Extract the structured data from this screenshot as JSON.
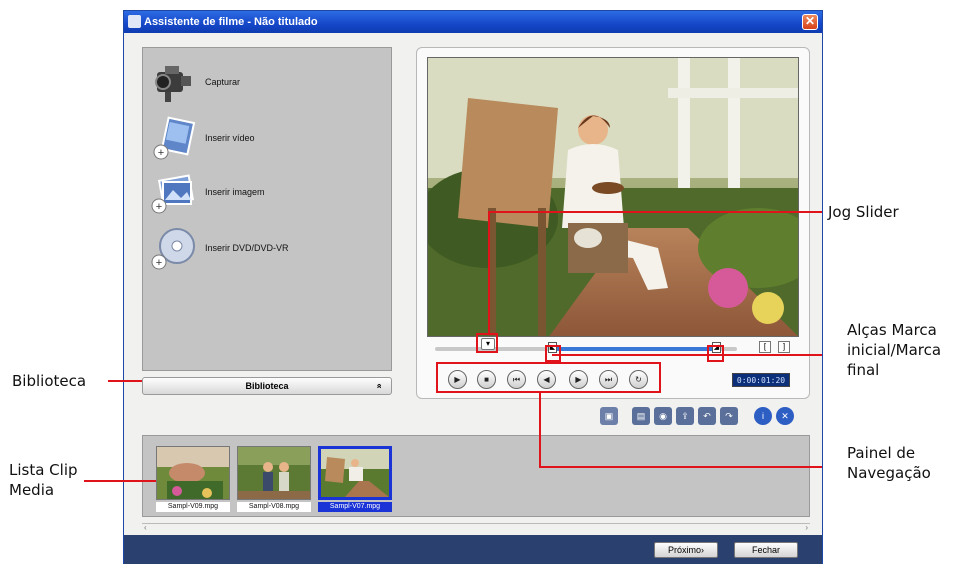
{
  "window": {
    "title": "Assistente de filme - Não titulado",
    "close_glyph": "✕"
  },
  "library": {
    "items": [
      {
        "label": "Capturar",
        "icon": "camcorder-icon"
      },
      {
        "label": "Inserir vídeo",
        "icon": "video-file-icon"
      },
      {
        "label": "Inserir imagem",
        "icon": "image-file-icon"
      },
      {
        "label": "Inserir DVD/DVD-VR",
        "icon": "dvd-disc-icon"
      }
    ],
    "bar_label": "Biblioteca",
    "bar_chevron": "»"
  },
  "preview": {
    "timecode": "0:00:01:20",
    "playhead_fraction": 0.19,
    "mark_in_fraction": 0.38,
    "mark_out_fraction": 0.92,
    "bracket_in": "[",
    "bracket_out": "]",
    "nav_buttons": [
      {
        "name": "play-button",
        "glyph": "▶"
      },
      {
        "name": "stop-button",
        "glyph": "■"
      },
      {
        "name": "home-button",
        "glyph": "⏮"
      },
      {
        "name": "previous-frame-button",
        "glyph": "◀"
      },
      {
        "name": "next-frame-button",
        "glyph": "▶"
      },
      {
        "name": "end-button",
        "glyph": "⏭"
      },
      {
        "name": "repeat-button",
        "glyph": "↻"
      }
    ]
  },
  "toolbar": {
    "icons": [
      "import-icon",
      "movie-template-icon",
      "theme-icon",
      "export-icon",
      "undo-icon",
      "redo-icon",
      "help-icon",
      "delete-icon"
    ]
  },
  "clips": [
    {
      "name": "Sampl-V09.mpg",
      "selected": false
    },
    {
      "name": "Sampl-V08.mpg",
      "selected": false
    },
    {
      "name": "Sampl-V07.mpg",
      "selected": true
    }
  ],
  "footer": {
    "next_label": "Próximo›",
    "close_label": "Fechar"
  },
  "annotations": {
    "jog_slider": "Jog Slider",
    "mark_handles": [
      "Alças Marca",
      "inicial/Marca",
      "final"
    ],
    "library": "Biblioteca",
    "nav_panel": [
      "Painel de",
      "Navegação"
    ],
    "clip_list": [
      "Lista Clip",
      "Media"
    ]
  },
  "colors": {
    "titlebar": "#1547c8",
    "annotation_red": "#e0121a",
    "selection_blue": "#1a33d6"
  }
}
